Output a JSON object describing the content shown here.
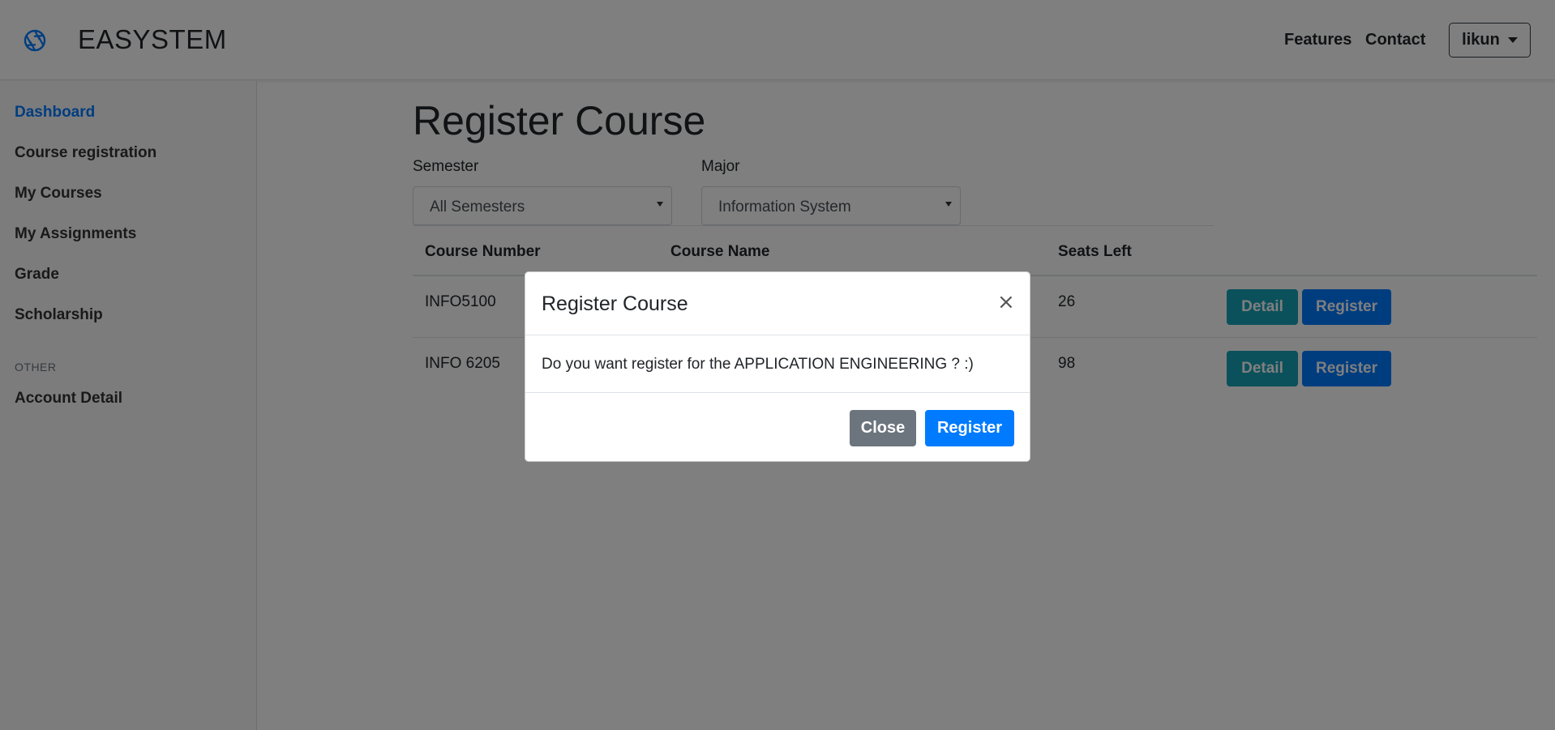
{
  "header": {
    "brand_icon": "aperture-icon",
    "brand_name": "EASYSTEM",
    "nav": {
      "features": "Features",
      "contact": "Contact"
    },
    "user": "likun"
  },
  "sidebar": {
    "items": [
      {
        "label": "Dashboard",
        "active": true
      },
      {
        "label": "Course registration"
      },
      {
        "label": "My Courses"
      },
      {
        "label": "My Assignments"
      },
      {
        "label": "Grade"
      },
      {
        "label": "Scholarship"
      }
    ],
    "other_heading": "OTHER",
    "other_items": [
      {
        "label": "Account Detail"
      }
    ]
  },
  "main": {
    "title": "Register Course",
    "semester_label": "Semester",
    "semester_value": "All Semesters",
    "major_label": "Major",
    "major_value": "Information System",
    "table": {
      "headers": [
        "Course Number",
        "Course Name",
        "Seats Left"
      ],
      "rows": [
        {
          "number": "INFO5100",
          "seats": "26",
          "detail": "Detail",
          "register": "Register"
        },
        {
          "number": "INFO 6205",
          "seats": "98",
          "detail": "Detail",
          "register": "Register"
        }
      ]
    }
  },
  "modal": {
    "title": "Register Course",
    "close_symbol": "×",
    "body": "Do you want register for the APPLICATION ENGINEERING ? :)",
    "close_label": "Close",
    "register_label": "Register"
  },
  "colors": {
    "primary": "#007bff",
    "info": "#17a2b8",
    "secondary": "#6c757d"
  }
}
